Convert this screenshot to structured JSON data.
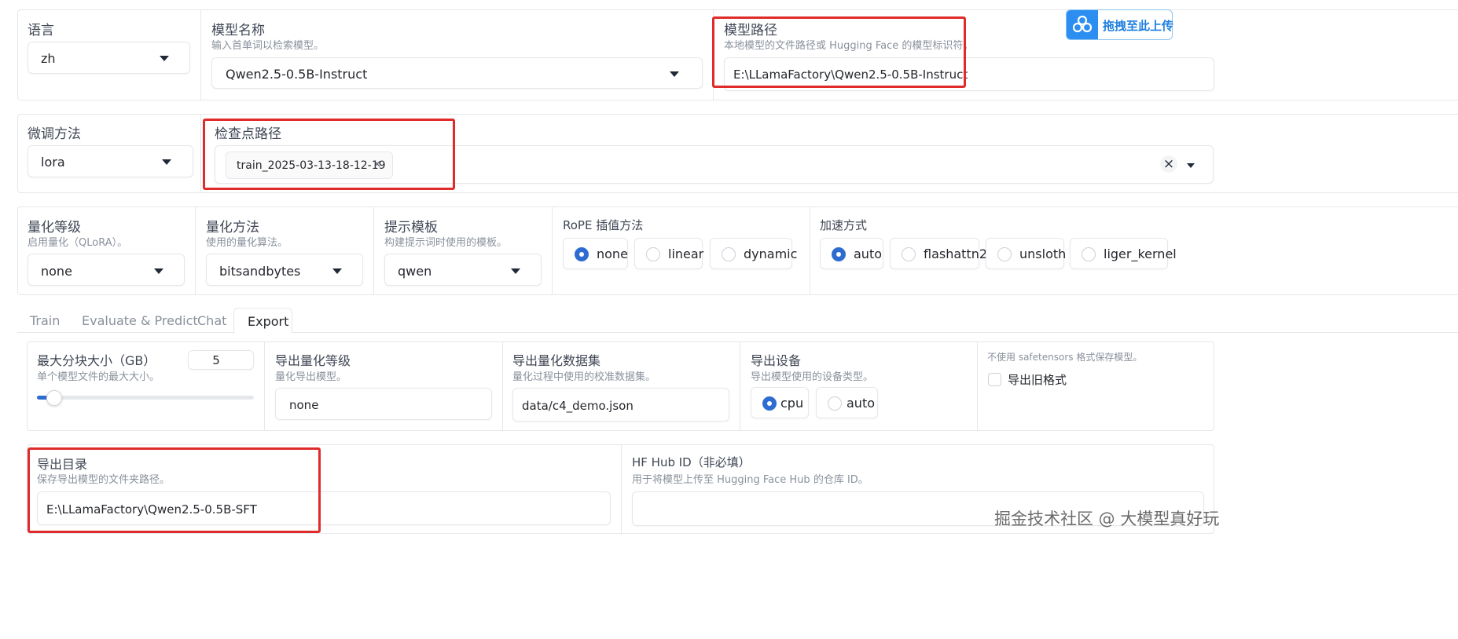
{
  "top": {
    "language": {
      "label": "语言",
      "value": "zh"
    },
    "model_name": {
      "label": "模型名称",
      "info": "输入首单词以检索模型。",
      "value": "Qwen2.5-0.5B-Instruct"
    },
    "model_path": {
      "label": "模型路径",
      "info": "本地模型的文件路径或 Hugging Face 的模型标识符。",
      "value": "E:\\LLamaFactory\\Qwen2.5-0.5B-Instruct"
    },
    "upload_badge": {
      "label": "拖拽至此上传"
    }
  },
  "finetune": {
    "method": {
      "label": "微调方法",
      "value": "lora"
    },
    "checkpoint": {
      "label": "检查点路径",
      "tag": "train_2025-03-13-18-12-19",
      "clear": "×"
    }
  },
  "quant": {
    "level": {
      "label": "量化等级",
      "info": "启用量化（QLoRA）。",
      "value": "none"
    },
    "method": {
      "label": "量化方法",
      "info": "使用的量化算法。",
      "value": "bitsandbytes"
    },
    "template": {
      "label": "提示模板",
      "info": "构建提示词时使用的模板。",
      "value": "qwen"
    },
    "rope": {
      "label": "RoPE 插值方法",
      "options": [
        "none",
        "linear",
        "dynamic"
      ],
      "selected": "none"
    },
    "booster": {
      "label": "加速方式",
      "options": [
        "auto",
        "flashattn2",
        "unsloth",
        "liger_kernel"
      ],
      "selected": "auto"
    }
  },
  "tabs": [
    "Train",
    "Evaluate & Predict",
    "Chat",
    "Export"
  ],
  "active_tab": "Export",
  "export": {
    "shard_size": {
      "label": "最大分块大小（GB）",
      "info": "单个模型文件的最大大小。",
      "value": "5",
      "slider_fraction": 0.035
    },
    "quant_bit": {
      "label": "导出量化等级",
      "info": "量化导出模型。",
      "value": "none"
    },
    "quant_dataset": {
      "label": "导出量化数据集",
      "info": "量化过程中使用的校准数据集。",
      "value": "data/c4_demo.json"
    },
    "device": {
      "label": "导出设备",
      "info": "导出模型使用的设备类型。",
      "options": [
        "cpu",
        "auto"
      ],
      "selected": "cpu"
    },
    "legacy": {
      "info": "不使用 safetensors 格式保存模型。",
      "label": "导出旧格式",
      "checked": false
    },
    "dir": {
      "label": "导出目录",
      "info": "保存导出模型的文件夹路径。",
      "value": "E:\\LLamaFactory\\Qwen2.5-0.5B-SFT"
    },
    "hub_id": {
      "label": "HF Hub ID（非必填）",
      "info": "用于将模型上传至 Hugging Face Hub 的仓库 ID。",
      "value": ""
    }
  },
  "watermark": "掘金技术社区 @ 大模型真好玩",
  "colors": {
    "accent": "#2f6cd1",
    "highlight": "#e02b2b",
    "border": "#e5e7eb"
  }
}
